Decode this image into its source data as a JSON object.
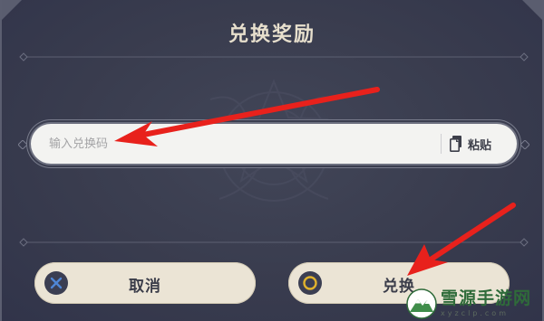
{
  "dialog": {
    "title": "兑换奖励",
    "input": {
      "placeholder": "输入兑换码",
      "value": ""
    },
    "paste_label": "粘贴",
    "cancel_label": "取消",
    "confirm_label": "兑换"
  },
  "watermark": {
    "site_name": "雪源手游网",
    "url": "xyzclp.com"
  },
  "colors": {
    "panel": "#3a3d4f",
    "title": "#e7dfcd",
    "button": "#ebe4d5",
    "arrow": "#e8211c",
    "cancel_icon": "#3d66b0",
    "confirm_icon": "#e0b22d"
  },
  "icons": [
    "paste-icon",
    "cross-icon",
    "circle-icon",
    "arrow-annotation"
  ]
}
